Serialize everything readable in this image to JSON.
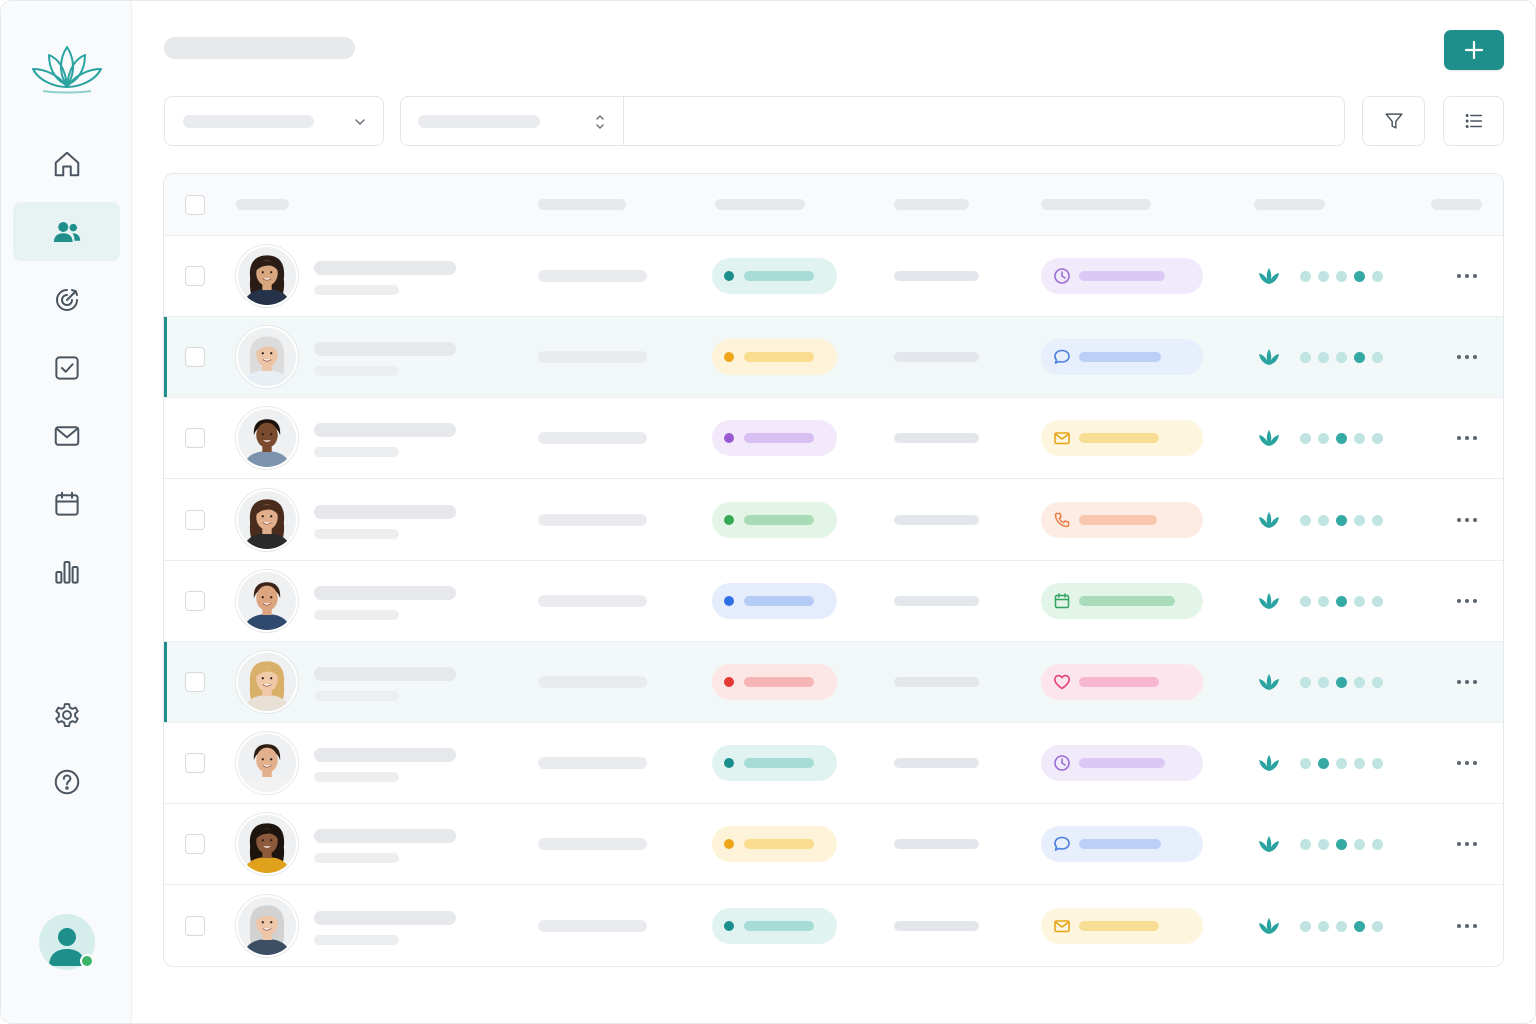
{
  "app": {
    "brand_icon": "lotus-logo-icon",
    "accent_color": "#1f8f8c"
  },
  "sidebar": {
    "items": [
      {
        "name": "home",
        "icon": "home-icon",
        "active": false
      },
      {
        "name": "contacts",
        "icon": "users-icon",
        "active": true
      },
      {
        "name": "goals",
        "icon": "target-icon",
        "active": false
      },
      {
        "name": "tasks",
        "icon": "checkbox-icon",
        "active": false
      },
      {
        "name": "messages",
        "icon": "mail-icon",
        "active": false
      },
      {
        "name": "calendar",
        "icon": "calendar-icon",
        "active": false
      },
      {
        "name": "reports",
        "icon": "bar-chart-icon",
        "active": false
      }
    ],
    "bottom_items": [
      {
        "name": "settings",
        "icon": "gear-icon"
      },
      {
        "name": "help",
        "icon": "help-circle-icon"
      }
    ],
    "user": {
      "icon": "user-avatar-icon",
      "status": "online",
      "status_color": "#3bb56a"
    }
  },
  "header": {
    "add_button_icon": "plus-icon"
  },
  "toolbar": {
    "dropdown_icon": "chevron-down-icon",
    "sort_icon": "sort-arrows-icon",
    "filter_icon": "filter-icon",
    "view_icon": "list-view-icon"
  },
  "table": {
    "rows": [
      {
        "highlighted": false,
        "status_color": "#1a8f8c",
        "status_bg": "#e1f3f1",
        "status_bar": "#a6dbd6",
        "activity": "clock",
        "activity_color": "#9b6cd6",
        "activity_bg": "#f1eafb",
        "activity_bar": "#dcc8f5",
        "rating": 4,
        "avatar": {
          "skin": "#d9a77f",
          "hair": "#2b1d16",
          "shirt": "#25324a",
          "long": true
        }
      },
      {
        "highlighted": true,
        "status_color": "#efa51a",
        "status_bg": "#fdf3d8",
        "status_bar": "#fadc8e",
        "activity": "chat",
        "activity_color": "#4a7fe0",
        "activity_bg": "#e8effc",
        "activity_bar": "#bcd0f7",
        "rating": 4,
        "avatar": {
          "skin": "#ecc4a6",
          "hair": "#dcdcdc",
          "shirt": "#e7eef4",
          "long": true
        }
      },
      {
        "highlighted": false,
        "status_color": "#9b5ad4",
        "status_bg": "#f2eafb",
        "status_bar": "#d7c0f1",
        "activity": "mail",
        "activity_color": "#e8a316",
        "activity_bg": "#fdf5dd",
        "activity_bar": "#f7de94",
        "rating": 3,
        "avatar": {
          "skin": "#7a4b2e",
          "hair": "#1c120c",
          "shirt": "#7d93ad",
          "long": false
        }
      },
      {
        "highlighted": false,
        "status_color": "#34a853",
        "status_bg": "#e3f5e6",
        "status_bar": "#a9dcb5",
        "activity": "phone",
        "activity_color": "#ec7e48",
        "activity_bg": "#fdece3",
        "activity_bar": "#f8c7ae",
        "rating": 3,
        "avatar": {
          "skin": "#e0ae8a",
          "hair": "#4a2c1c",
          "shirt": "#2b2b2b",
          "long": true
        }
      },
      {
        "highlighted": false,
        "status_color": "#2f6fe4",
        "status_bg": "#e5edfd",
        "status_bar": "#b4cbf6",
        "activity": "calendar",
        "activity_color": "#31a35c",
        "activity_bg": "#e3f5e8",
        "activity_bar": "#a9dcbb",
        "rating": 3,
        "avatar": {
          "skin": "#dca580",
          "hair": "#3a2518",
          "shirt": "#2f4a6d",
          "long": false
        }
      },
      {
        "highlighted": true,
        "status_color": "#e53935",
        "status_bg": "#fde6e6",
        "status_bar": "#f6b5b5",
        "activity": "heart",
        "activity_color": "#e2407a",
        "activity_bg": "#fde5ee",
        "activity_bar": "#f7b6cf",
        "rating": 3,
        "avatar": {
          "skin": "#f0c9a8",
          "hair": "#d9b06a",
          "shirt": "#e8e0d4",
          "long": true
        }
      },
      {
        "highlighted": false,
        "status_color": "#1a8f8c",
        "status_bg": "#e1f3f1",
        "status_bar": "#a6dbd6",
        "activity": "clock",
        "activity_color": "#9b6cd6",
        "activity_bg": "#f1eafb",
        "activity_bar": "#dcc8f5",
        "rating": 2,
        "avatar": {
          "skin": "#e2b08c",
          "hair": "#2e1e14",
          "shirt": "#f2f2f2",
          "long": false
        }
      },
      {
        "highlighted": false,
        "status_color": "#efa51a",
        "status_bg": "#fdf3d8",
        "status_bar": "#fadc8e",
        "activity": "chat",
        "activity_color": "#4a7fe0",
        "activity_bg": "#e8effc",
        "activity_bar": "#bcd0f7",
        "rating": 3,
        "avatar": {
          "skin": "#8d5a3b",
          "hair": "#1e140e",
          "shirt": "#e0a21c",
          "long": true
        }
      },
      {
        "highlighted": false,
        "status_color": "#1a8f8c",
        "status_bg": "#e1f3f1",
        "status_bar": "#a6dbd6",
        "activity": "mail",
        "activity_color": "#e8a316",
        "activity_bg": "#fdf5dd",
        "activity_bar": "#f7de94",
        "rating": 4,
        "avatar": {
          "skin": "#eec7ab",
          "hair": "#d2d2d2",
          "shirt": "#3c4e63",
          "long": true
        }
      }
    ]
  }
}
